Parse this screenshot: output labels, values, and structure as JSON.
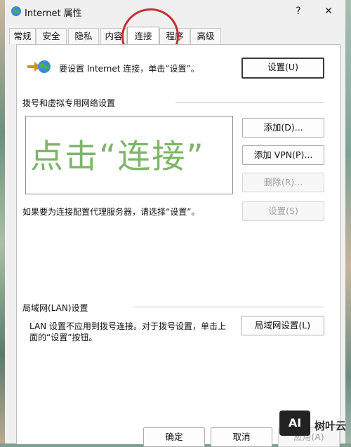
{
  "window": {
    "title": "Internet 属性",
    "help_label": "?",
    "close_label": "✕",
    "icon": "globe-icon"
  },
  "tabs": [
    "常规",
    "安全",
    "隐私",
    "内容",
    "连接",
    "程序",
    "高级"
  ],
  "active_tab": "连接",
  "setup": {
    "text": "要设置 Internet 连接，单击“设置”。",
    "button": "设置(U)"
  },
  "dialup": {
    "heading": "拨号和虚拟专用网络设置",
    "add_button": "添加(D)...",
    "add_vpn_button": "添加 VPN(P)...",
    "remove_button": "删除(R)...",
    "settings_button": "设置(S)",
    "proxy_text": "如果要为连接配置代理服务器，请选择“设置”。"
  },
  "annotation": {
    "text": "点击“连接”",
    "color": "#7fb56a",
    "circle_color": "#c03030"
  },
  "lan": {
    "heading": "局域网(LAN)设置",
    "text_line1": "LAN 设置不应用到拨号连接。对于拨号设置，单击上",
    "text_line2": "面的“设置”按钮。",
    "button": "局域网设置(L)"
  },
  "footer": {
    "ok": "确定",
    "cancel": "取消",
    "apply": "应用(A)"
  },
  "watermark": {
    "logo": "AI",
    "text": "树叶云"
  }
}
